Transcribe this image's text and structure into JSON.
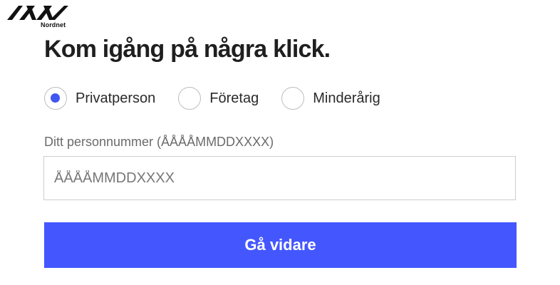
{
  "brand": {
    "name": "Nordnet",
    "logo_icon": "nordnet-logo-icon"
  },
  "heading": "Kom igång på några klick.",
  "account_type": {
    "options": [
      {
        "label": "Privatperson",
        "checked": true
      },
      {
        "label": "Företag",
        "checked": false
      },
      {
        "label": "Minderårig",
        "checked": false
      }
    ],
    "accent_color": "#4157f0"
  },
  "personnummer": {
    "label": "Ditt personnummer (ÅÅÅÅMMDDXXXX)",
    "placeholder": "ÅÅÅÅMMDDXXXX",
    "value": ""
  },
  "submit": {
    "label": "Gå vidare",
    "color": "#4457ff"
  }
}
